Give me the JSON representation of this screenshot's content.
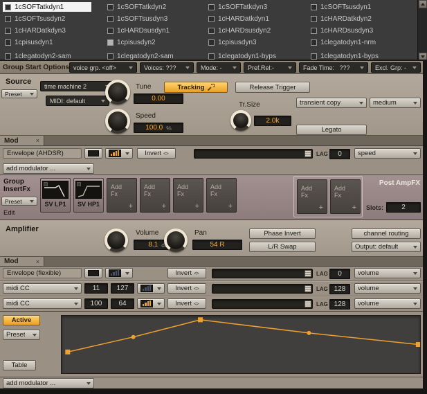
{
  "icons": {
    "close": "×",
    "invert": "<>"
  },
  "colors": {
    "accent_orange": "#e8a235",
    "meter_blue": "#44506e",
    "value_orange": "#f2a93c"
  },
  "group_list": {
    "items": [
      {
        "label": "1cSOFTatkdyn1",
        "state": "selected"
      },
      {
        "label": "1cSOFTatkdyn2",
        "state": "normal"
      },
      {
        "label": "1cSOFTatkdyn3",
        "state": "normal"
      },
      {
        "label": "1cSOFTsusdyn1",
        "state": "normal"
      },
      {
        "label": "1cSOFTsusdyn2",
        "state": "normal"
      },
      {
        "label": "1cSOFTsusdyn3",
        "state": "normal"
      },
      {
        "label": "1cHARDatkdyn1",
        "state": "normal"
      },
      {
        "label": "1cHARDatkdyn2",
        "state": "normal"
      },
      {
        "label": "1cHARDatkdyn3",
        "state": "normal"
      },
      {
        "label": "1cHARDsusdyn1",
        "state": "normal"
      },
      {
        "label": "1cHARDsusdyn2",
        "state": "normal"
      },
      {
        "label": "1cHARDsusdyn3",
        "state": "normal"
      },
      {
        "label": "1cpisusdyn1",
        "state": "normal"
      },
      {
        "label": "1cpisusdyn2",
        "state": "checked"
      },
      {
        "label": "1cpisusdyn3",
        "state": "normal"
      },
      {
        "label": "1clegatodyn1-nrm",
        "state": "normal"
      },
      {
        "label": "1clegatodyn2-sam",
        "state": "normal"
      },
      {
        "label": "1clegatodyn2-sam",
        "state": "normal"
      },
      {
        "label": "1clegatodyn1-byps",
        "state": "normal"
      },
      {
        "label": "1clegatodyn1-byps",
        "state": "normal"
      }
    ]
  },
  "group_start_options": {
    "title": "Group Start Options",
    "voice_grp": "voice grp. <off>",
    "voices": "Voices: ???",
    "mode": "Mode: -",
    "pref_rel": "Pref.Rel:-",
    "fade_time": "Fade Time:   ???",
    "excl_grp": "Excl. Grp: -"
  },
  "source": {
    "title": "Source",
    "preset": "Preset",
    "engine_mode": "time machine 2",
    "midi_mode": "MIDI: default",
    "tune": {
      "label": "Tune",
      "value": "0.00"
    },
    "tracking_button": "Tracking",
    "release_trigger_button": "Release Trigger",
    "speed": {
      "label": "Speed",
      "value": "100.0",
      "unit": "%"
    },
    "tr_size": {
      "label": "Tr.Size",
      "value": "2.0k"
    },
    "transient_copy": "transient copy",
    "quality": "medium",
    "legato_button": "Legato"
  },
  "mod_source": {
    "tab": "Mod",
    "row": {
      "label": "Envelope (AHDSR)",
      "invert": "Invert",
      "lag_label": "LAG",
      "lag_value": "0",
      "target": "speed",
      "meter_color": "#e8a235",
      "slider_pos": 1.0
    },
    "add_modulator": "add modulator ..."
  },
  "insert_fx": {
    "title_line1": "Group",
    "title_line2": "InsertFx",
    "preset": "Preset",
    "edit": "Edit",
    "add_fx_label": "Add",
    "add_fx_label2": "Fx",
    "plus": "+",
    "slots": [
      {
        "label": "SV LP1",
        "type": "lowpass"
      },
      {
        "label": "SV HP1",
        "type": "highpass"
      },
      {
        "label": "Add Fx",
        "type": "empty"
      },
      {
        "label": "Add Fx",
        "type": "empty"
      },
      {
        "label": "Add Fx",
        "type": "empty"
      },
      {
        "label": "Add Fx",
        "type": "empty"
      },
      {
        "label": "Add Fx",
        "type": "empty"
      },
      {
        "label": "Add Fx",
        "type": "empty"
      }
    ],
    "post_ampfx": "Post AmpFX",
    "slots_label": "Slots:",
    "slots_value": "2"
  },
  "amplifier": {
    "title": "Amplifier",
    "volume": {
      "label": "Volume",
      "value": "8.1",
      "unit": "dB"
    },
    "pan": {
      "label": "Pan",
      "value": "54 R"
    },
    "phase_invert_button": "Phase Invert",
    "lr_swap_button": "L/R Swap",
    "channel_routing_button": "channel routing",
    "output": "Output: default"
  },
  "mod_amp": {
    "tab": "Mod",
    "rows": [
      {
        "label": "Envelope (flexible)",
        "type": "env",
        "invert": "Invert",
        "lag_label": "LAG",
        "lag_value": "0",
        "target": "volume",
        "meter_color": "#44506e",
        "slider_pos": 1.0
      },
      {
        "label": "midi CC",
        "type": "cc",
        "value1": "11",
        "value2": "127",
        "invert": "Invert",
        "lag_label": "LAG",
        "lag_value": "128",
        "target": "volume",
        "meter_color": "#44506e",
        "slider_pos": 1.0
      },
      {
        "label": "midi CC",
        "type": "cc",
        "value1": "100",
        "value2": "64",
        "invert": "Invert",
        "lag_label": "LAG",
        "lag_value": "128",
        "target": "volume",
        "meter_color": "#e8a235",
        "slider_pos": 1.0
      }
    ]
  },
  "envelope_editor": {
    "active_button": "Active",
    "preset": "Preset",
    "table_button": "Table",
    "curve_color": "#eda12f",
    "points": [
      {
        "x": 0.017,
        "y": 0.63,
        "marker": "square"
      },
      {
        "x": 0.2,
        "y": 0.37,
        "marker": "circle"
      },
      {
        "x": 0.387,
        "y": 0.07,
        "marker": "square"
      },
      {
        "x": 0.69,
        "y": 0.3,
        "marker": "circle"
      },
      {
        "x": 0.995,
        "y": 0.5,
        "marker": "square"
      }
    ],
    "add_modulator": "add modulator ..."
  }
}
